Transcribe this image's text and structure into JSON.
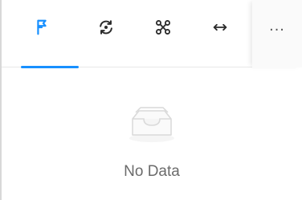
{
  "tabs": [
    {
      "icon": "flag-icon",
      "active": true
    },
    {
      "icon": "refresh-cycle-icon",
      "active": false
    },
    {
      "icon": "node-graph-icon",
      "active": false
    },
    {
      "icon": "double-arrow-horizontal-icon",
      "active": false
    }
  ],
  "more": {
    "label": "..."
  },
  "empty_state": {
    "icon": "empty-inbox-icon",
    "text": "No Data"
  },
  "colors": {
    "accent": "#1890ff",
    "icon": "#2b2b2b",
    "muted_text": "#6b6b6b"
  }
}
